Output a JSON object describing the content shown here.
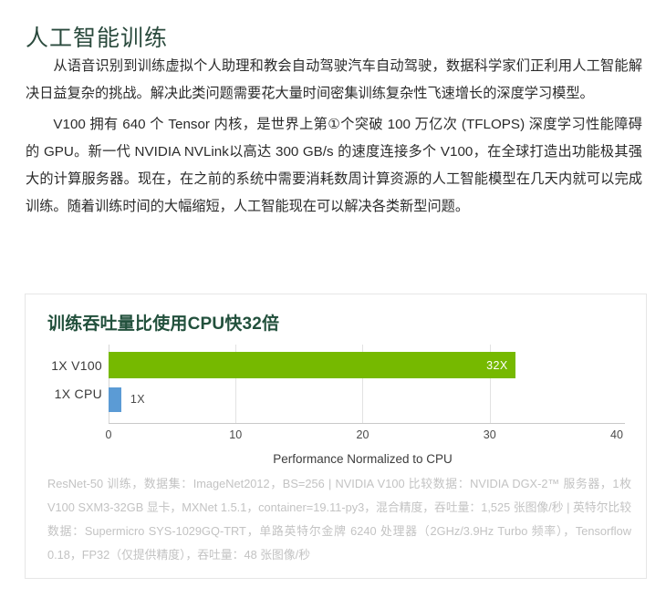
{
  "article": {
    "title": "人工智能训练",
    "paragraphs": [
      "从语音识别到训练虚拟个人助理和教会自动驾驶汽车自动驾驶，数据科学家们正利用人工智能解决日益复杂的挑战。解决此类问题需要花大量时间密集训练复杂性飞速增长的深度学习模型。",
      "V100 拥有 640 个 Tensor 内核，是世界上第①个突破 100 万亿次 (TFLOPS) 深度学习性能障碍的 GPU。新一代 NVIDIA NVLink以高达 300 GB/s 的速度连接多个 V100，在全球打造出功能极其强大的计算服务器。现在，在之前的系统中需要消耗数周计算资源的人工智能模型在几天内就可以完成训练。随着训练时间的大幅缩短，人工智能现在可以解决各类新型问题。"
    ]
  },
  "chart_card": {
    "footnote": "ResNet-50 训练，数据集：ImageNet2012，BS=256 | NVIDIA V100 比较数据：NVIDIA DGX-2™ 服务器，1枚 V100 SXM3-32GB 显卡，MXNet 1.5.1，container=19.11-py3，混合精度，吞吐量：1,525 张图像/秒 | 英特尔比较数据：Supermicro SYS-1029GQ-TRT，单路英特尔金牌 6240 处理器（2GHz/3.9Hz Turbo 频率），Tensorflow 0.18，FP32（仅提供精度），吞吐量：48 张图像/秒"
  },
  "chart_data": {
    "type": "bar",
    "orientation": "horizontal",
    "title": "训练吞吐量比使用CPU快32倍",
    "categories": [
      "1X V100",
      "1X CPU"
    ],
    "values": [
      32,
      1
    ],
    "value_labels": [
      "32X",
      "1X"
    ],
    "series": [
      {
        "name": "1X V100",
        "value": 32,
        "label": "32X",
        "color": "#76b900"
      },
      {
        "name": "1X CPU",
        "value": 1,
        "label": "1X",
        "color": "#5b9bd5"
      }
    ],
    "xlabel": "Performance Normalized to CPU",
    "ylabel": "",
    "xlim": [
      0,
      40
    ],
    "xticks": [
      0,
      10,
      20,
      30,
      40
    ],
    "xtick_labels": [
      "0",
      "10",
      "20",
      "30",
      "40"
    ],
    "grid": "vertical",
    "legend": "none"
  },
  "colors": {
    "heading_green": "#2a4a3d",
    "chart_title_green": "#22503c",
    "nvidia_green": "#76b900",
    "cpu_blue": "#5b9bd5",
    "footnote_gray": "#c3c3c3",
    "card_border": "#e6e6e6"
  }
}
